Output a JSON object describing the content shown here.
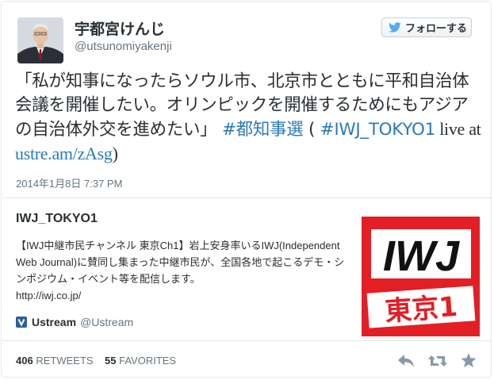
{
  "user": {
    "name": "宇都宮けんじ",
    "handle": "@utsunomiyakenji"
  },
  "follow_button": {
    "label": "フォローする",
    "icon": "twitter-bird-icon"
  },
  "tweet": {
    "text_main": "「私が知事になったらソウル市、北京市とともに平和自治体会議を開催したい。オリンピックを開催するためにもアジアの自治体外交を進めたい」",
    "hashtag1": "#都知事選",
    "paren_open": " ( ",
    "hashtag2": "#IWJ_TOKYO1",
    "live": " live at ",
    "link": "ustre.am/zAsg",
    "paren_close": ")"
  },
  "timestamp": "2014年1月8日 7:37 PM",
  "card": {
    "title": "IWJ_TOKYO1",
    "description": "【IWJ中継市民チャンネル 東京Ch1】岩上安身率いるIWJ(Independent Web Journal)に賛同し集まった中継市民が、全国各地で起こるデモ・シンポジウム・イベント等を配信します。",
    "url": "http://iwj.co.jp/",
    "via_brand": "Ustream",
    "via_account": "@Ustream",
    "thumbnail": {
      "top_text": "IWJ",
      "bottom_text": "東京1",
      "colors": {
        "red": "#e31e24",
        "black": "#111111",
        "white": "#ffffff"
      }
    }
  },
  "stats": {
    "retweets_count": "406",
    "retweets_label": "RETWEETS",
    "favorites_count": "55",
    "favorites_label": "FAVORITES"
  },
  "actions": [
    "reply-icon",
    "retweet-icon",
    "favorite-icon"
  ],
  "colors": {
    "link": "#2b7bb9",
    "text": "#292f33",
    "muted": "#66757f",
    "border": "#e1e8ed"
  }
}
